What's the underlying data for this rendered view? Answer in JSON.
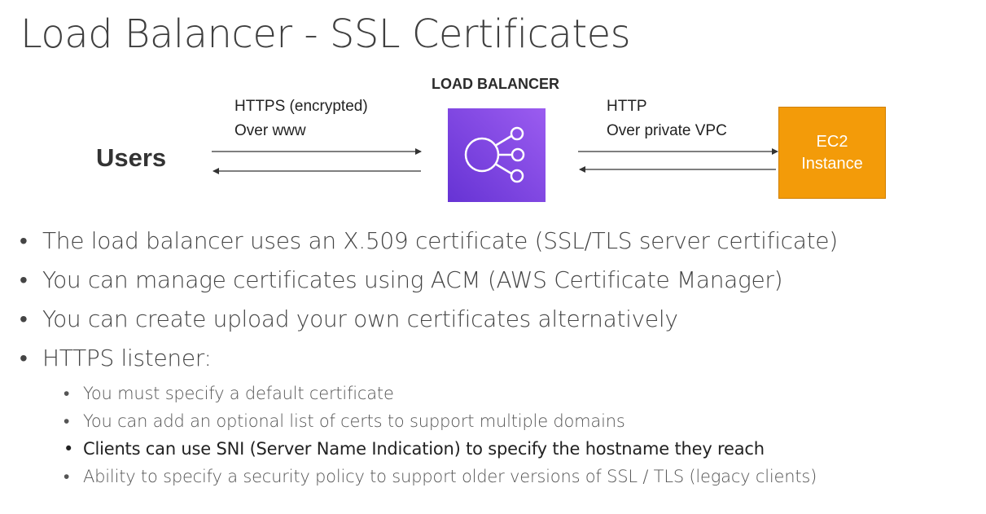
{
  "title": "Load Balancer - SSL Certificates",
  "diagram": {
    "load_balancer_label": "LOAD BALANCER",
    "users_label": "Users",
    "left_edge": {
      "line1": "HTTPS (encrypted)",
      "line2": "Over www"
    },
    "right_edge": {
      "line1": "HTTP",
      "line2": "Over private VPC"
    },
    "ec2": {
      "line1": "EC2",
      "line2": "Instance"
    },
    "icons": {
      "load_balancer": "load-balancer-icon"
    },
    "colors": {
      "load_balancer_bg": "#7b45e0",
      "ec2_bg": "#f39b09"
    }
  },
  "bullets": [
    "The load balancer uses an X.509 certificate (SSL/TLS server certificate)",
    "You can manage certificates using ACM (AWS Certificate Manager)",
    "You can create upload your own certificates alternatively",
    "HTTPS listener:"
  ],
  "sub_bullets": [
    "You must specify a default certificate",
    "You can add an optional list of certs to support multiple domains",
    "Clients can use SNI (Server Name Indication) to specify the hostname they reach",
    "Ability to specify a security policy to support older versions of SSL / TLS (legacy clients)"
  ]
}
